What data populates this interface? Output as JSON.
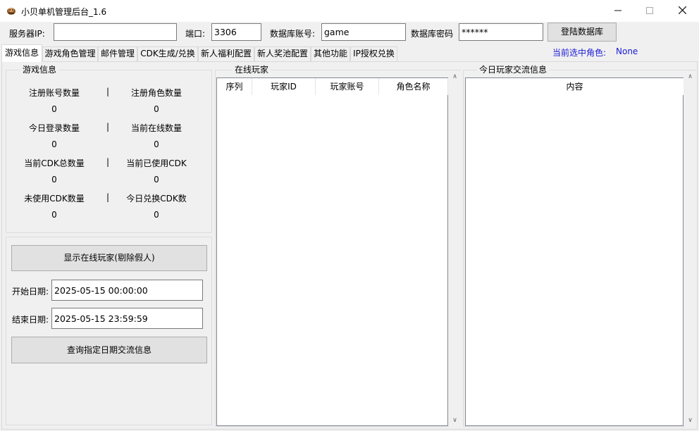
{
  "window": {
    "title": "小贝单机管理后台_1.6"
  },
  "connection": {
    "server_ip_label": "服务器IP:",
    "server_ip_value": "",
    "port_label": "端口:",
    "port_value": "3306",
    "db_account_label": "数据库账号:",
    "db_account_value": "game",
    "db_password_label": "数据库密码",
    "db_password_value": "******",
    "login_button": "登陆数据库"
  },
  "tabs": [
    {
      "label": "游戏信息",
      "active": true
    },
    {
      "label": "游戏角色管理"
    },
    {
      "label": "邮件管理"
    },
    {
      "label": "CDK生成/兑换"
    },
    {
      "label": "新人福利配置"
    },
    {
      "label": "新人奖池配置"
    },
    {
      "label": "其他功能"
    },
    {
      "label": "IP授权兑换"
    }
  ],
  "selected_role": {
    "label": "当前选中角色:",
    "value": "None"
  },
  "game_info": {
    "title": "游戏信息",
    "separator": "|",
    "rows": [
      {
        "left_label": "注册账号数量",
        "left_value": "0",
        "right_label": "注册角色数量",
        "right_value": "0"
      },
      {
        "left_label": "今日登录数量",
        "left_value": "0",
        "right_label": "当前在线数量",
        "right_value": "0"
      },
      {
        "left_label": "当前CDK总数量",
        "left_value": "0",
        "right_label": "当前已使用CDK",
        "right_value": "0"
      },
      {
        "left_label": "未使用CDK数量",
        "left_value": "0",
        "right_label": "今日兑换CDK数",
        "right_value": "0"
      }
    ]
  },
  "controls": {
    "show_online_button": "显示在线玩家(剔除假人)",
    "start_date_label": "开始日期:",
    "start_date_value": "2025-05-15 00:00:00",
    "end_date_label": "结束日期:",
    "end_date_value": "2025-05-15 23:59:59",
    "query_button": "查询指定日期交流信息"
  },
  "online_players": {
    "title": "在线玩家",
    "columns": [
      "序列",
      "玩家ID",
      "玩家账号",
      "角色名称"
    ]
  },
  "chat": {
    "title": "今日玩家交流信息",
    "columns": [
      "内容"
    ]
  }
}
